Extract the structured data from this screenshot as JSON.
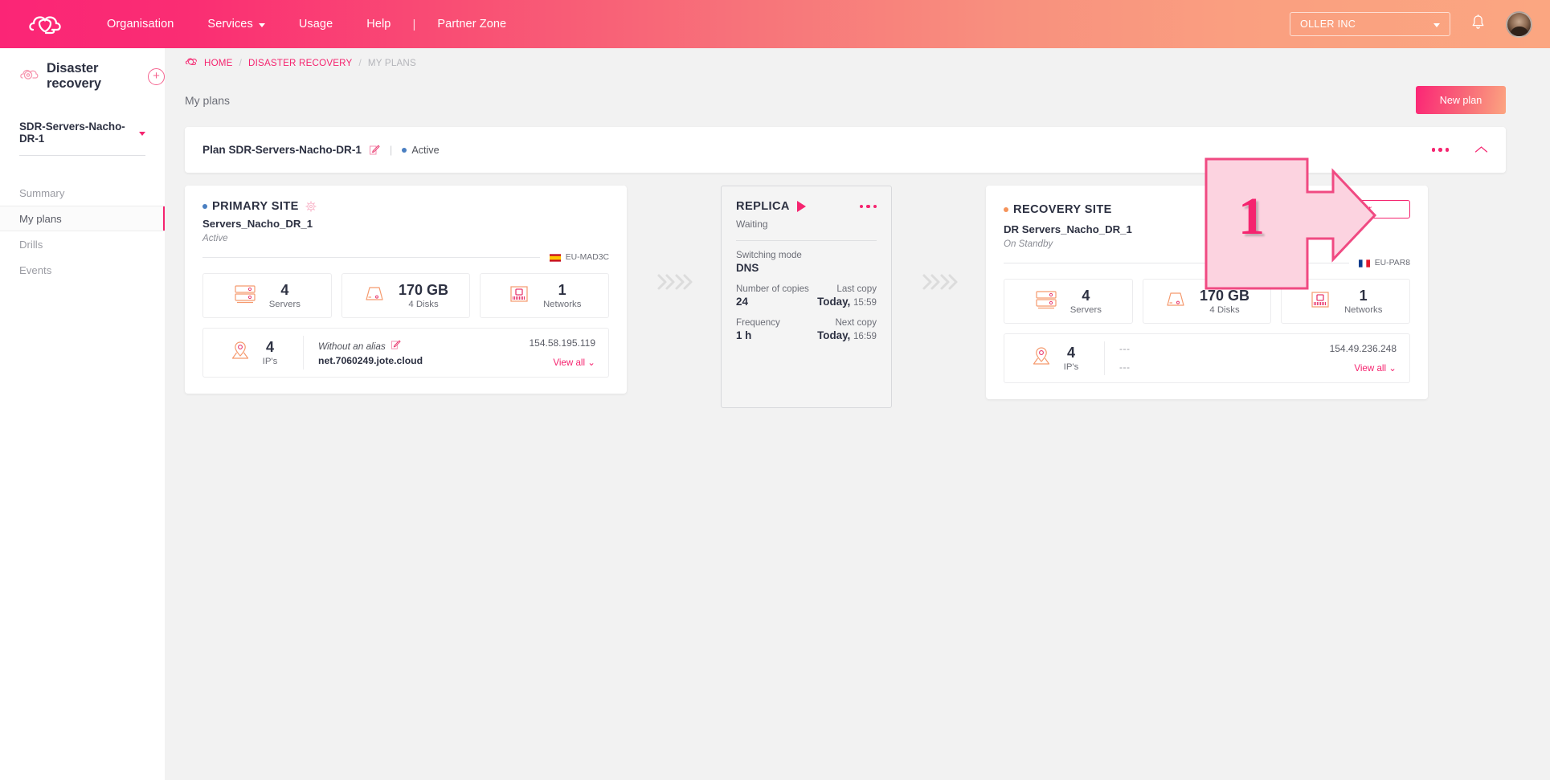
{
  "topbar": {
    "logo_icon": "cloud-logo-icon",
    "nav": [
      {
        "label": "Organisation",
        "has_caret": false
      },
      {
        "label": "Services",
        "has_caret": true
      },
      {
        "label": "Usage",
        "has_caret": false
      },
      {
        "label": "Help",
        "has_caret": false
      },
      {
        "label": "Partner Zone",
        "has_caret": false
      }
    ],
    "separator": "|",
    "org_selector": "OLLER INC",
    "bell_icon": "notification-bell-icon",
    "avatar_icon": "user-avatar"
  },
  "sidebar": {
    "title": "Disaster recovery",
    "add_label": "+",
    "plan_selector": "SDR-Servers-Nacho-DR-1",
    "items": [
      {
        "label": "Summary",
        "active": false
      },
      {
        "label": "My plans",
        "active": true
      },
      {
        "label": "Drills",
        "active": false
      },
      {
        "label": "Events",
        "active": false
      }
    ]
  },
  "breadcrumb": {
    "home": "HOME",
    "section": "DISASTER RECOVERY",
    "current": "MY PLANS",
    "separator": "/"
  },
  "page": {
    "title": "My plans",
    "new_plan_button": "New plan"
  },
  "plan_panel": {
    "name": "Plan SDR-Servers-Nacho-DR-1",
    "edit_icon": "edit-pencil-icon",
    "divider": "|",
    "status": "Active",
    "more_icon": "more-options-icon",
    "collapse_icon": "chevron-up-icon"
  },
  "primary_site": {
    "kind": "PRIMARY SITE",
    "gear_icon": "gear-icon",
    "name": "Servers_Nacho_DR_1",
    "state": "Active",
    "region": "EU-MAD3C",
    "region_flag": "flag-spain",
    "stats": [
      {
        "icon": "servers-icon",
        "value": "4",
        "sub": "Servers"
      },
      {
        "icon": "disk-icon",
        "value": "170 GB",
        "sub": "4 Disks"
      },
      {
        "icon": "network-icon",
        "value": "1",
        "sub": "Networks"
      }
    ],
    "ip": {
      "icon": "location-pin-icon",
      "count": "4",
      "label": "IP's",
      "alias": "Without an alias",
      "alias_edit_icon": "edit-pencil-icon",
      "host": "net.7060249.jote.cloud",
      "address": "154.58.195.119",
      "view_all": "View all"
    }
  },
  "replica": {
    "title": "REPLICA",
    "play_icon": "play-icon",
    "more_icon": "more-options-icon",
    "state": "Waiting",
    "switching_mode_label": "Switching mode",
    "switching_mode_value": "DNS",
    "copies_label": "Number of copies",
    "copies_value": "24",
    "last_copy_label": "Last copy",
    "last_copy_day": "Today,",
    "last_copy_time": "15:59",
    "frequency_label": "Frequency",
    "frequency_value": "1 h",
    "next_copy_label": "Next copy",
    "next_copy_day": "Today,",
    "next_copy_time": "16:59"
  },
  "recovery_site": {
    "kind": "RECOVERY SITE",
    "name": "DR Servers_Nacho_DR_1",
    "state": "On Standby",
    "region": "EU-PAR8",
    "region_flag": "flag-france",
    "failover_button": "Failover",
    "stats": [
      {
        "icon": "servers-icon",
        "value": "4",
        "sub": "Servers"
      },
      {
        "icon": "disk-icon",
        "value": "170 GB",
        "sub": "4 Disks"
      },
      {
        "icon": "network-icon",
        "value": "1",
        "sub": "Networks"
      }
    ],
    "ip": {
      "icon": "location-pin-icon",
      "count": "4",
      "label": "IP's",
      "alias": "---",
      "host": "---",
      "address": "154.49.236.248",
      "view_all": "View all"
    }
  },
  "annotation": {
    "step_number": "1",
    "shape": "arrow-callout-right"
  },
  "colors": {
    "brand_pink": "#f5246f",
    "brand_peach": "#fba681",
    "annotation_fill": "#fcd3e0",
    "annotation_stroke": "#f04a82",
    "status_active": "#4a7fc1",
    "status_standby": "#f5935a"
  }
}
